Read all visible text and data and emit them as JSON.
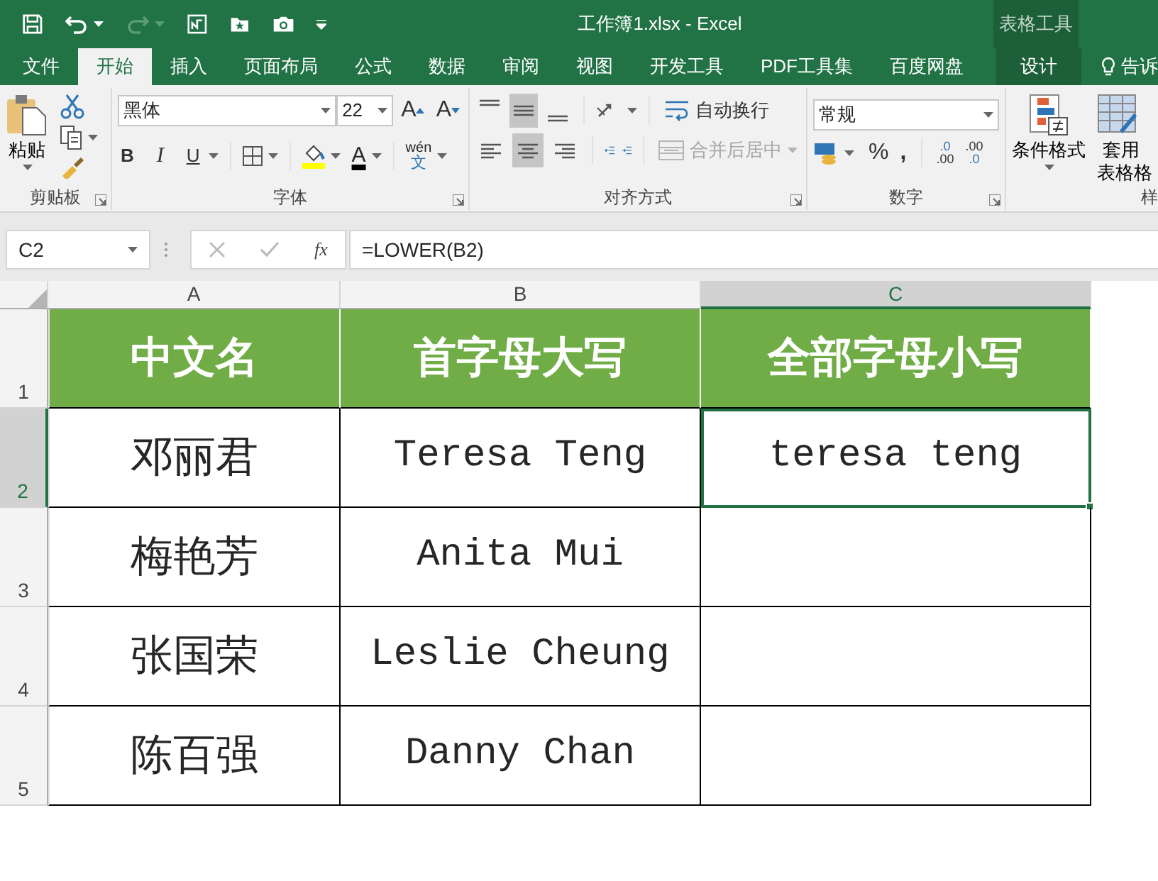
{
  "window": {
    "title": "工作簿1.xlsx - Excel",
    "context_group": "表格工具"
  },
  "ribbon_tabs": [
    {
      "label": "文件",
      "selected": false,
      "kind": "file"
    },
    {
      "label": "开始",
      "selected": true,
      "kind": "tab"
    },
    {
      "label": "插入",
      "selected": false,
      "kind": "tab"
    },
    {
      "label": "页面布局",
      "selected": false,
      "kind": "tab"
    },
    {
      "label": "公式",
      "selected": false,
      "kind": "tab"
    },
    {
      "label": "数据",
      "selected": false,
      "kind": "tab"
    },
    {
      "label": "审阅",
      "selected": false,
      "kind": "tab"
    },
    {
      "label": "视图",
      "selected": false,
      "kind": "tab"
    },
    {
      "label": "开发工具",
      "selected": false,
      "kind": "tab"
    },
    {
      "label": "PDF工具集",
      "selected": false,
      "kind": "tab"
    },
    {
      "label": "百度网盘",
      "selected": false,
      "kind": "tab"
    },
    {
      "label": "设计",
      "selected": false,
      "kind": "context"
    },
    {
      "label": "告诉",
      "selected": false,
      "kind": "tell"
    }
  ],
  "clipboard": {
    "paste": "粘贴",
    "group_label": "剪贴板"
  },
  "font": {
    "name": "黑体",
    "size": "22",
    "bold": "B",
    "italic": "I",
    "underline": "U",
    "grow": "A",
    "shrink": "A",
    "font_color": "A",
    "phonetic_top": "wén",
    "phonetic_bottom": "文",
    "group_label": "字体"
  },
  "alignment": {
    "vertical": [
      {
        "selected": false
      },
      {
        "selected": true
      },
      {
        "selected": false
      }
    ],
    "horizontal": [
      {
        "selected": false
      },
      {
        "selected": true
      },
      {
        "selected": false
      }
    ],
    "wrap_text": "自动换行",
    "merge_center": {
      "label": "合并后居中",
      "disabled": true
    },
    "group_label": "对齐方式"
  },
  "number": {
    "format": "常规",
    "percent": "%",
    "comma": ",",
    "increase_decimal": {
      "top": ".0",
      "bottom": ".00"
    },
    "decrease_decimal": {
      "top": ".00",
      "bottom": ".0"
    },
    "group_label": "数字"
  },
  "styles": {
    "conditional_format": "条件格式",
    "table_format": [
      "套用",
      "表格格"
    ],
    "group_label": "样"
  },
  "formula_bar": {
    "name_box": "C2",
    "fx": "fx",
    "formula": "=LOWER(B2)"
  },
  "sheet": {
    "columns": [
      {
        "label": "A",
        "selected": false
      },
      {
        "label": "B",
        "selected": false
      },
      {
        "label": "C",
        "selected": true
      }
    ],
    "rows": [
      {
        "header": "1",
        "selected": false,
        "kind": "heading",
        "cells": [
          {
            "text": "中文名",
            "selected": false
          },
          {
            "text": "首字母大写",
            "selected": false
          },
          {
            "text": "全部字母小写",
            "selected": false
          }
        ]
      },
      {
        "header": "2",
        "selected": true,
        "kind": "data",
        "cells": [
          {
            "text": "邓丽君",
            "selected": false
          },
          {
            "text": "Teresa Teng",
            "selected": false
          },
          {
            "text": "teresa teng",
            "selected": true
          }
        ]
      },
      {
        "header": "3",
        "selected": false,
        "kind": "data",
        "cells": [
          {
            "text": "梅艳芳",
            "selected": false
          },
          {
            "text": "Anita Mui",
            "selected": false
          },
          {
            "selected": false
          }
        ]
      },
      {
        "header": "4",
        "selected": false,
        "kind": "data",
        "cells": [
          {
            "text": "张国荣",
            "selected": false
          },
          {
            "text": "Leslie Cheung",
            "selected": false
          },
          {
            "selected": false
          }
        ]
      },
      {
        "header": "5",
        "selected": false,
        "kind": "data",
        "cells": [
          {
            "text": "陈百强",
            "selected": false
          },
          {
            "text": "Danny Chan",
            "selected": false
          },
          {
            "selected": false
          }
        ]
      }
    ]
  }
}
